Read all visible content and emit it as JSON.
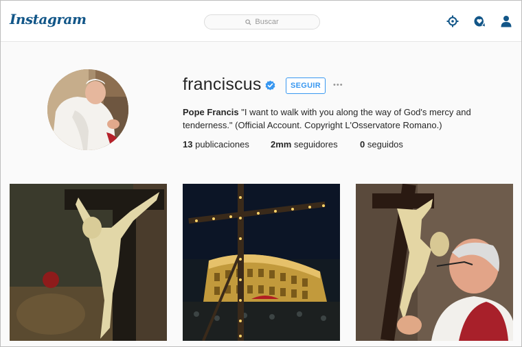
{
  "header": {
    "logo": "Instagram",
    "search_placeholder": "Buscar",
    "icons": [
      "explore-icon",
      "activity-icon",
      "profile-icon"
    ]
  },
  "profile": {
    "username": "franciscus",
    "verified": true,
    "follow_label": "SEGUIR",
    "more_label": "•••",
    "full_name": "Pope Francis",
    "bio": "\"I want to walk with you along the way of God's mercy and tenderness.\" (Official Account. Copyright L'Osservatore Romano.)",
    "stats": {
      "posts_count": "13",
      "posts_label": "publicaciones",
      "followers_count": "2mm",
      "followers_label": "seguidores",
      "following_count": "0",
      "following_label": "seguidos"
    }
  },
  "posts": [
    {
      "subject": "crucifix"
    },
    {
      "subject": "colosseum-night-cross"
    },
    {
      "subject": "pope-kissing-crucifix"
    }
  ],
  "colors": {
    "accent": "#3897f0",
    "logo": "#125688",
    "icon": "#125688"
  }
}
